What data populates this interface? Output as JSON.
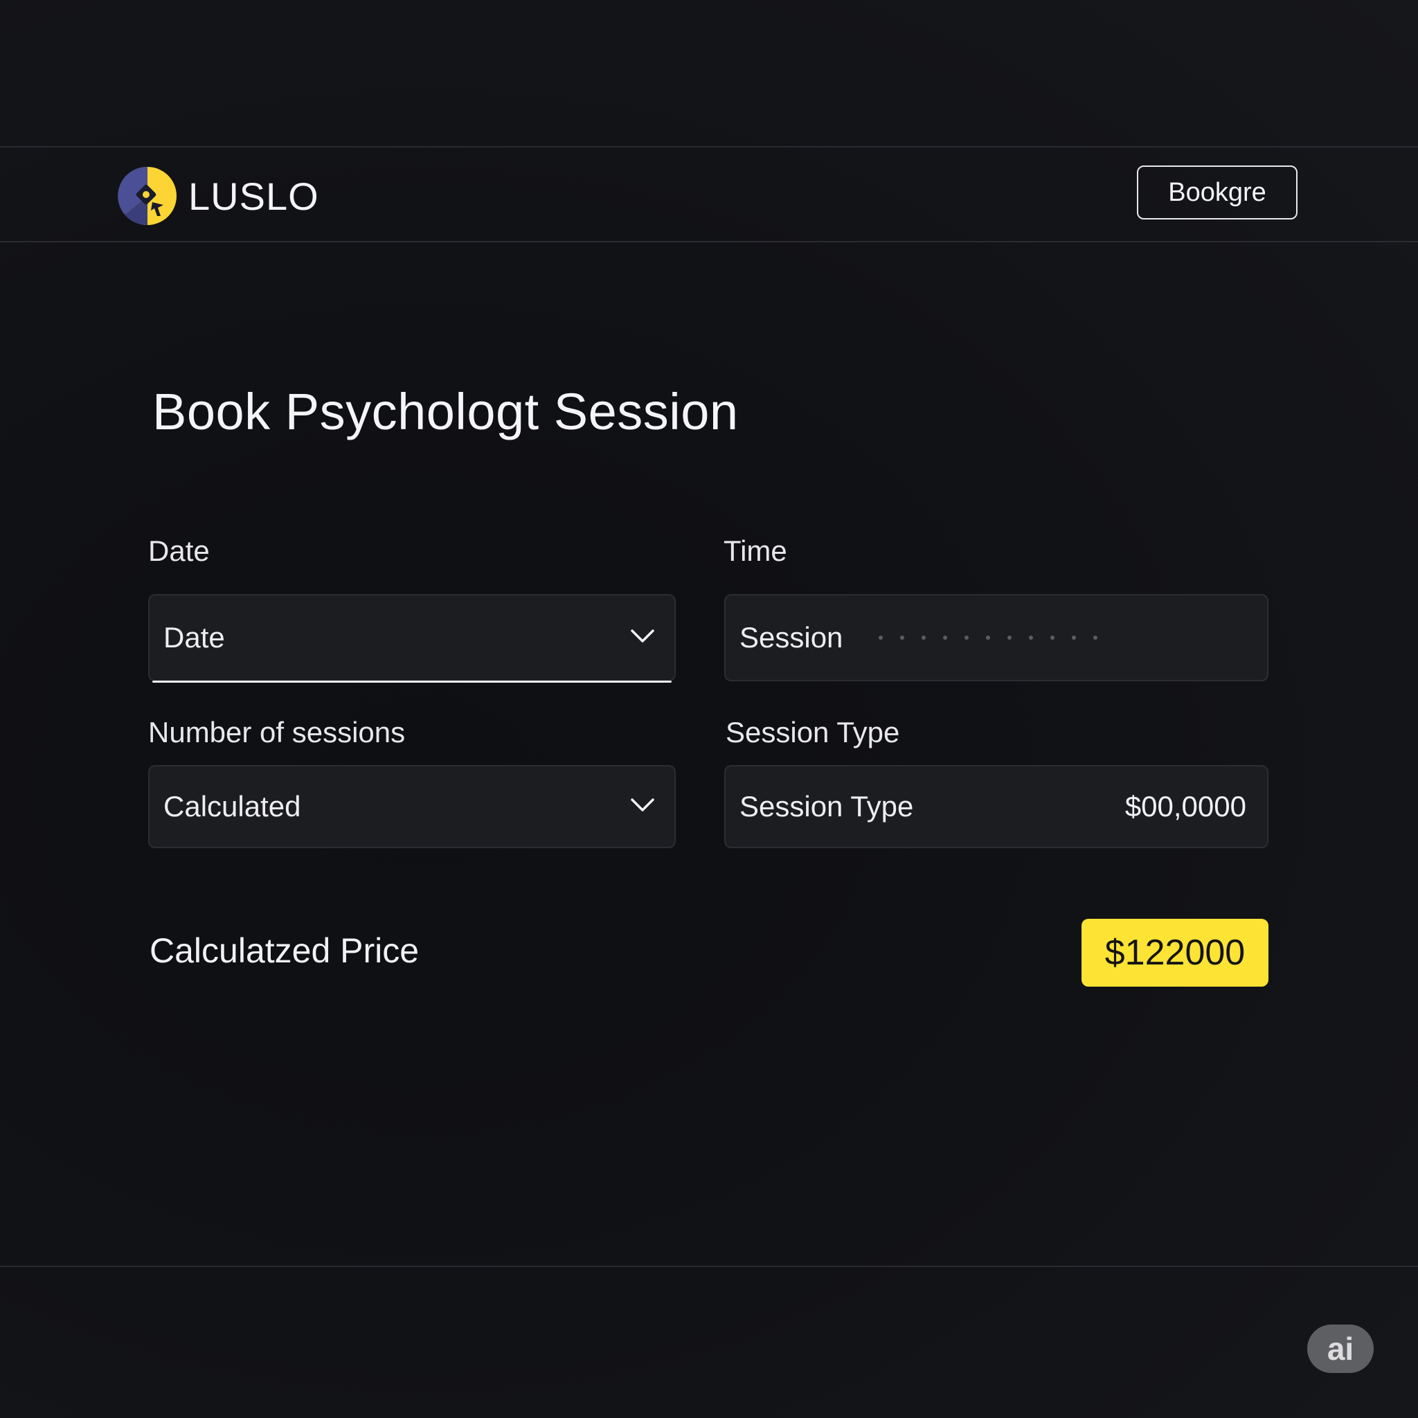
{
  "brand": {
    "name": "LUSLO",
    "colors": {
      "yellow": "#fcd534",
      "indigo": "#4a4f96"
    }
  },
  "header": {
    "cta_label": "Bookgre"
  },
  "page": {
    "title": "Book Psychologt Session"
  },
  "form": {
    "date": {
      "label": "Date",
      "value": "Date",
      "icon": "chevron-down-icon"
    },
    "time": {
      "label": "Time",
      "value": "Session"
    },
    "sessions": {
      "label": "Number of sessions",
      "value": "Calculated",
      "icon": "chevron-down-icon"
    },
    "session_type": {
      "label": "Session Type",
      "value": "Session Type",
      "price": "$00,0000"
    }
  },
  "summary": {
    "label": "Calculatzed Price",
    "price": "$122000",
    "accent_color": "#fde334"
  },
  "corner_badge": {
    "label": "ai"
  }
}
